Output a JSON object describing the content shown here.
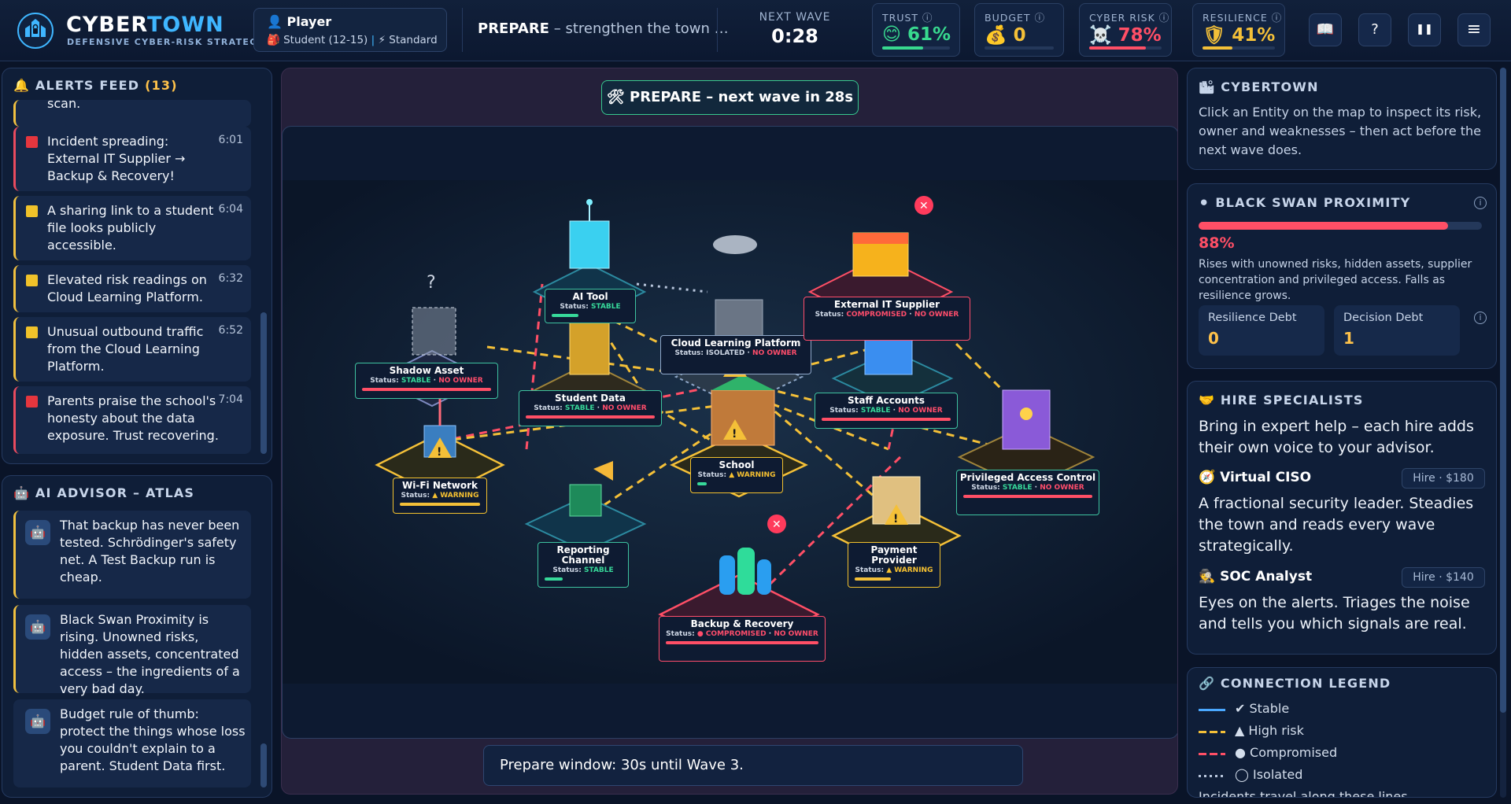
{
  "header": {
    "brand_part1": "CYBER",
    "brand_part2": "TOWN",
    "subtitle": "DEFENSIVE CYBER-RISK STRATEGY",
    "player_label": "Player",
    "player_group": "Student (12-15)",
    "player_mode": "Standard",
    "phase_name": "PREPARE",
    "phase_desc": "– strengthen the town …",
    "next_wave_label": "NEXT WAVE",
    "next_wave_time": "0:28",
    "stats": [
      {
        "label": "TRUST",
        "emoji": "😊",
        "value": "61%",
        "fill": 0.61,
        "color": "#38d98f"
      },
      {
        "label": "BUDGET",
        "emoji": "💰",
        "value": "0",
        "fill": 0.0,
        "color": "#f4c038"
      },
      {
        "label": "CYBER RISK",
        "emoji": "☠️",
        "value": "78%",
        "fill": 0.78,
        "color": "#ff4f66"
      },
      {
        "label": "RESILIENCE",
        "emoji": "🛡",
        "value": "41%",
        "fill": 0.41,
        "color": "#f4c038"
      }
    ],
    "buttons": {
      "guide": "📖",
      "help": "?",
      "pause": "❚❚",
      "menu": "≡"
    }
  },
  "alerts": {
    "title": "ALERTS FEED",
    "count": "(13)",
    "clipped_text": "scan.",
    "items": [
      {
        "text": "Incident spreading: External IT Supplier → Backup & Recovery!",
        "time": "6:01",
        "level": "red"
      },
      {
        "text": "A sharing link to a student file looks publicly accessible.",
        "time": "6:04",
        "level": "yellow"
      },
      {
        "text": "Elevated risk readings on Cloud Learning Platform.",
        "time": "6:32",
        "level": "yellow"
      },
      {
        "text": "Unusual outbound traffic from the Cloud Learning Platform.",
        "time": "6:52",
        "level": "yellow"
      },
      {
        "text": "Parents praise the school's honesty about the data exposure. Trust recovering.",
        "time": "7:04",
        "level": "red"
      }
    ]
  },
  "advisor": {
    "title": "AI ADVISOR – ATLAS",
    "messages": [
      "That backup has never been tested. Schrödinger's safety net. A Test Backup run is cheap.",
      "Black Swan Proximity is rising. Unowned risks, hidden assets, concentrated access – the ingredients of a very bad day.",
      "Budget rule of thumb: protect the things whose loss you couldn't explain to a parent. Student Data first."
    ]
  },
  "map": {
    "banner": "🛠 PREPARE – next wave in 28s",
    "footer": "Prepare window: 30s until Wave 3.",
    "entities": [
      {
        "name": "AI Tool",
        "status_word": "STABLE",
        "owner": "",
        "state": "ok"
      },
      {
        "name": "Cloud Learning Platform",
        "status_word": "ISOLATED",
        "owner": "NO OWNER",
        "state": "iso"
      },
      {
        "name": "External IT Supplier",
        "status_word": "COMPROMISED",
        "owner": "NO OWNER",
        "state": "bad"
      },
      {
        "name": "Shadow Asset",
        "status_word": "STABLE",
        "owner": "NO OWNER",
        "state": "ok"
      },
      {
        "name": "Student Data",
        "status_word": "STABLE",
        "owner": "NO OWNER",
        "state": "ok"
      },
      {
        "name": "Staff Accounts",
        "status_word": "STABLE",
        "owner": "NO OWNER",
        "state": "ok"
      },
      {
        "name": "Wi-Fi Network",
        "status_word": "WARNING",
        "owner": "",
        "state": "warn"
      },
      {
        "name": "School",
        "status_word": "WARNING",
        "owner": "",
        "state": "warn"
      },
      {
        "name": "Privileged Access Control",
        "status_word": "STABLE",
        "owner": "NO OWNER",
        "state": "ok"
      },
      {
        "name": "Reporting Channel",
        "status_word": "STABLE",
        "owner": "",
        "state": "ok"
      },
      {
        "name": "Payment Provider",
        "status_word": "WARNING",
        "owner": "",
        "state": "warn"
      },
      {
        "name": "Backup & Recovery",
        "status_word": "COMPROMISED",
        "owner": "NO OWNER",
        "state": "bad"
      }
    ],
    "status_prefix": "Status:"
  },
  "info": {
    "title": "CYBERTOWN",
    "text": "Click an Entity on the map to inspect its risk, owner and weaknesses – then act before the next wave does."
  },
  "black_swan": {
    "title": "BLACK SWAN PROXIMITY",
    "value": "88%",
    "fill": 0.88,
    "desc": "Rises with unowned risks, hidden assets, supplier concentration and privileged access. Falls as resilience grows.",
    "resilience_debt_label": "Resilience Debt",
    "resilience_debt_value": "0",
    "decision_debt_label": "Decision Debt",
    "decision_debt_value": "1"
  },
  "hire": {
    "title": "HIRE SPECIALISTS",
    "intro": "Bring in expert help – each hire adds their own voice to your advisor.",
    "specialists": [
      {
        "name": "Virtual CISO",
        "icon": "🧭",
        "price": "Hire · $180",
        "desc": "A fractional security leader. Steadies the town and reads every wave strategically."
      },
      {
        "name": "SOC Analyst",
        "icon": "🕵",
        "price": "Hire · $140",
        "desc": "Eyes on the alerts. Triages the noise and tells you which signals are real."
      }
    ]
  },
  "legend": {
    "title": "CONNECTION LEGEND",
    "items": [
      {
        "label": "✔ Stable",
        "color": "#4aa8ff",
        "style": "solid"
      },
      {
        "label": "▲ High risk",
        "color": "#f4c038",
        "style": "dashed"
      },
      {
        "label": "● Compromised",
        "color": "#ff4f66",
        "style": "dashed"
      },
      {
        "label": "◯ Isolated",
        "color": "#b8c6dc",
        "style": "dotted"
      }
    ],
    "clipped_text": "Incidents travel along these lines."
  },
  "colors": {
    "accent": "#3fb6ff",
    "ok": "#37d99a",
    "warn": "#f4c038",
    "bad": "#ff4f66"
  }
}
